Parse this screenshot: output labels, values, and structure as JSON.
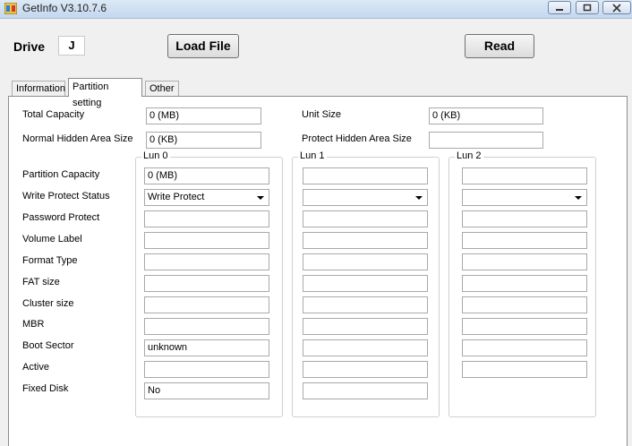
{
  "window": {
    "title": "GetInfo V3.10.7.6"
  },
  "top": {
    "drive_label": "Drive",
    "drive_value": "J",
    "load_label": "Load File",
    "read_label": "Read"
  },
  "tabs": [
    {
      "label": "Information"
    },
    {
      "label": "Partition setting"
    },
    {
      "label": "Other"
    }
  ],
  "general": {
    "total_capacity_label": "Total Capacity",
    "total_capacity_value": "0 (MB)",
    "unit_size_label": "Unit Size",
    "unit_size_value": "0 (KB)",
    "normal_hidden_label": "Normal Hidden Area Size",
    "normal_hidden_value": "0 (KB)",
    "protect_hidden_label": "Protect Hidden Area Size",
    "protect_hidden_value": ""
  },
  "rows": {
    "partition_capacity": "Partition Capacity",
    "write_protect_status": "Write Protect Status",
    "password_protect": "Password Protect",
    "volume_label": "Volume Label",
    "format_type": "Format Type",
    "fat_size": "FAT size",
    "cluster_size": "Cluster size",
    "mbr": "MBR",
    "boot_sector": "Boot Sector",
    "active": "Active",
    "fixed_disk": "Fixed Disk"
  },
  "luns": [
    {
      "title": "Lun 0",
      "partition_capacity": "0 (MB)",
      "write_protect_status": "Write Protect",
      "password_protect": "",
      "volume_label": "",
      "format_type": "",
      "fat_size": "",
      "cluster_size": "",
      "mbr": "",
      "boot_sector": "unknown",
      "active": "",
      "fixed_disk": "No"
    },
    {
      "title": "Lun 1",
      "partition_capacity": "",
      "write_protect_status": "",
      "password_protect": "",
      "volume_label": "",
      "format_type": "",
      "fat_size": "",
      "cluster_size": "",
      "mbr": "",
      "boot_sector": "",
      "active": "",
      "fixed_disk": ""
    },
    {
      "title": "Lun 2",
      "partition_capacity": "",
      "write_protect_status": "",
      "password_protect": "",
      "volume_label": "",
      "format_type": "",
      "fat_size": "",
      "cluster_size": "",
      "mbr": "",
      "boot_sector": "",
      "active": ""
    }
  ],
  "icons": {
    "app": "app-icon",
    "minimize": "minimize-icon",
    "maximize": "maximize-icon",
    "close": "close-icon"
  }
}
